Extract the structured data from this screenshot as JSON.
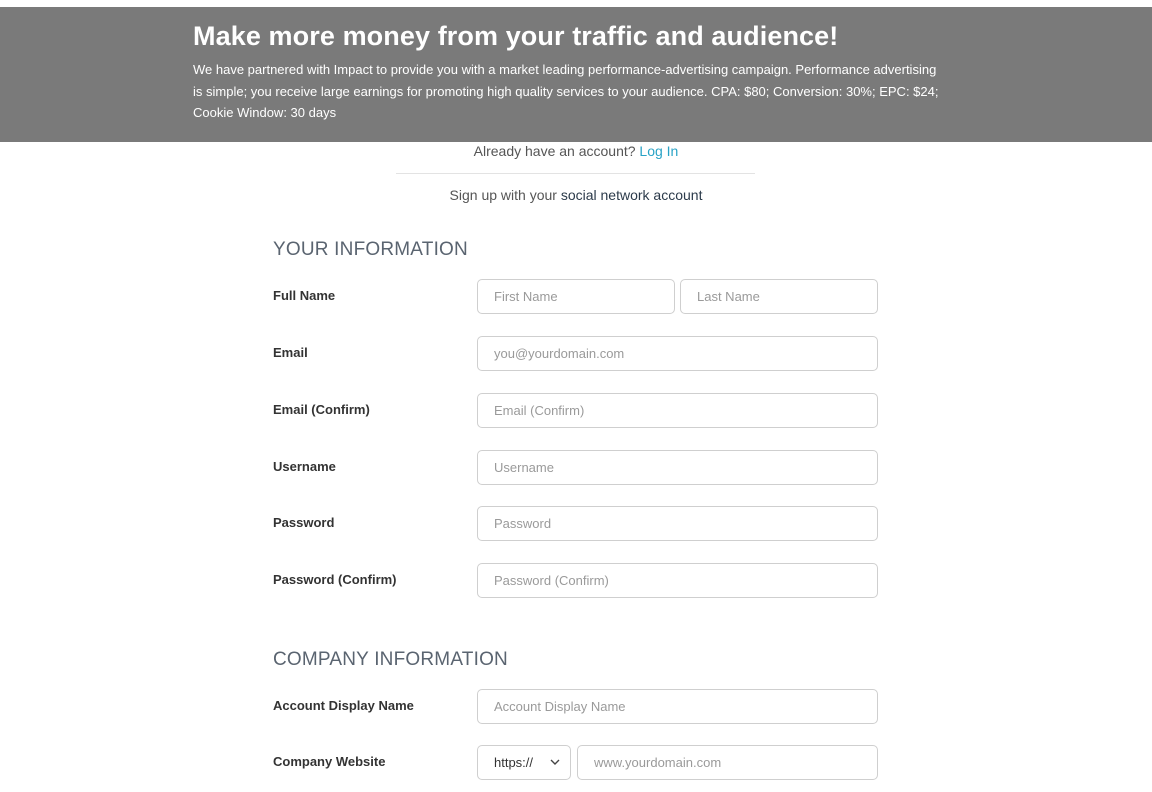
{
  "banner": {
    "title": "Make more money from your traffic and audience!",
    "text": "We have partnered with Impact to provide you with a market leading performance-advertising campaign. Performance advertising is simple; you receive large earnings for promoting high quality services to your audience. CPA: $80; Conversion: 30%; EPC: $24; Cookie Window: 30 days"
  },
  "login": {
    "prompt": "Already have an account?",
    "link": "Log In"
  },
  "social": {
    "prefix": "Sign up with your",
    "link": "social network account"
  },
  "your_information": {
    "title": "YOUR INFORMATION",
    "full_name_label": "Full Name",
    "first_name_placeholder": "First Name",
    "last_name_placeholder": "Last Name",
    "email_label": "Email",
    "email_placeholder": "you@yourdomain.com",
    "email_confirm_label": "Email (Confirm)",
    "email_confirm_placeholder": "Email (Confirm)",
    "username_label": "Username",
    "username_placeholder": "Username",
    "password_label": "Password",
    "password_placeholder": "Password",
    "password_confirm_label": "Password (Confirm)",
    "password_confirm_placeholder": "Password (Confirm)"
  },
  "company_information": {
    "title": "COMPANY INFORMATION",
    "display_name_label": "Account Display Name",
    "display_name_placeholder": "Account Display Name",
    "website_label": "Company Website",
    "protocol_value": "https://",
    "website_placeholder": "www.yourdomain.com"
  },
  "icons": {
    "protocol_dropdown": "chevron-down-icon"
  },
  "colors": {
    "banner_bg": "#7a7a7a",
    "link": "#29a3c6"
  }
}
